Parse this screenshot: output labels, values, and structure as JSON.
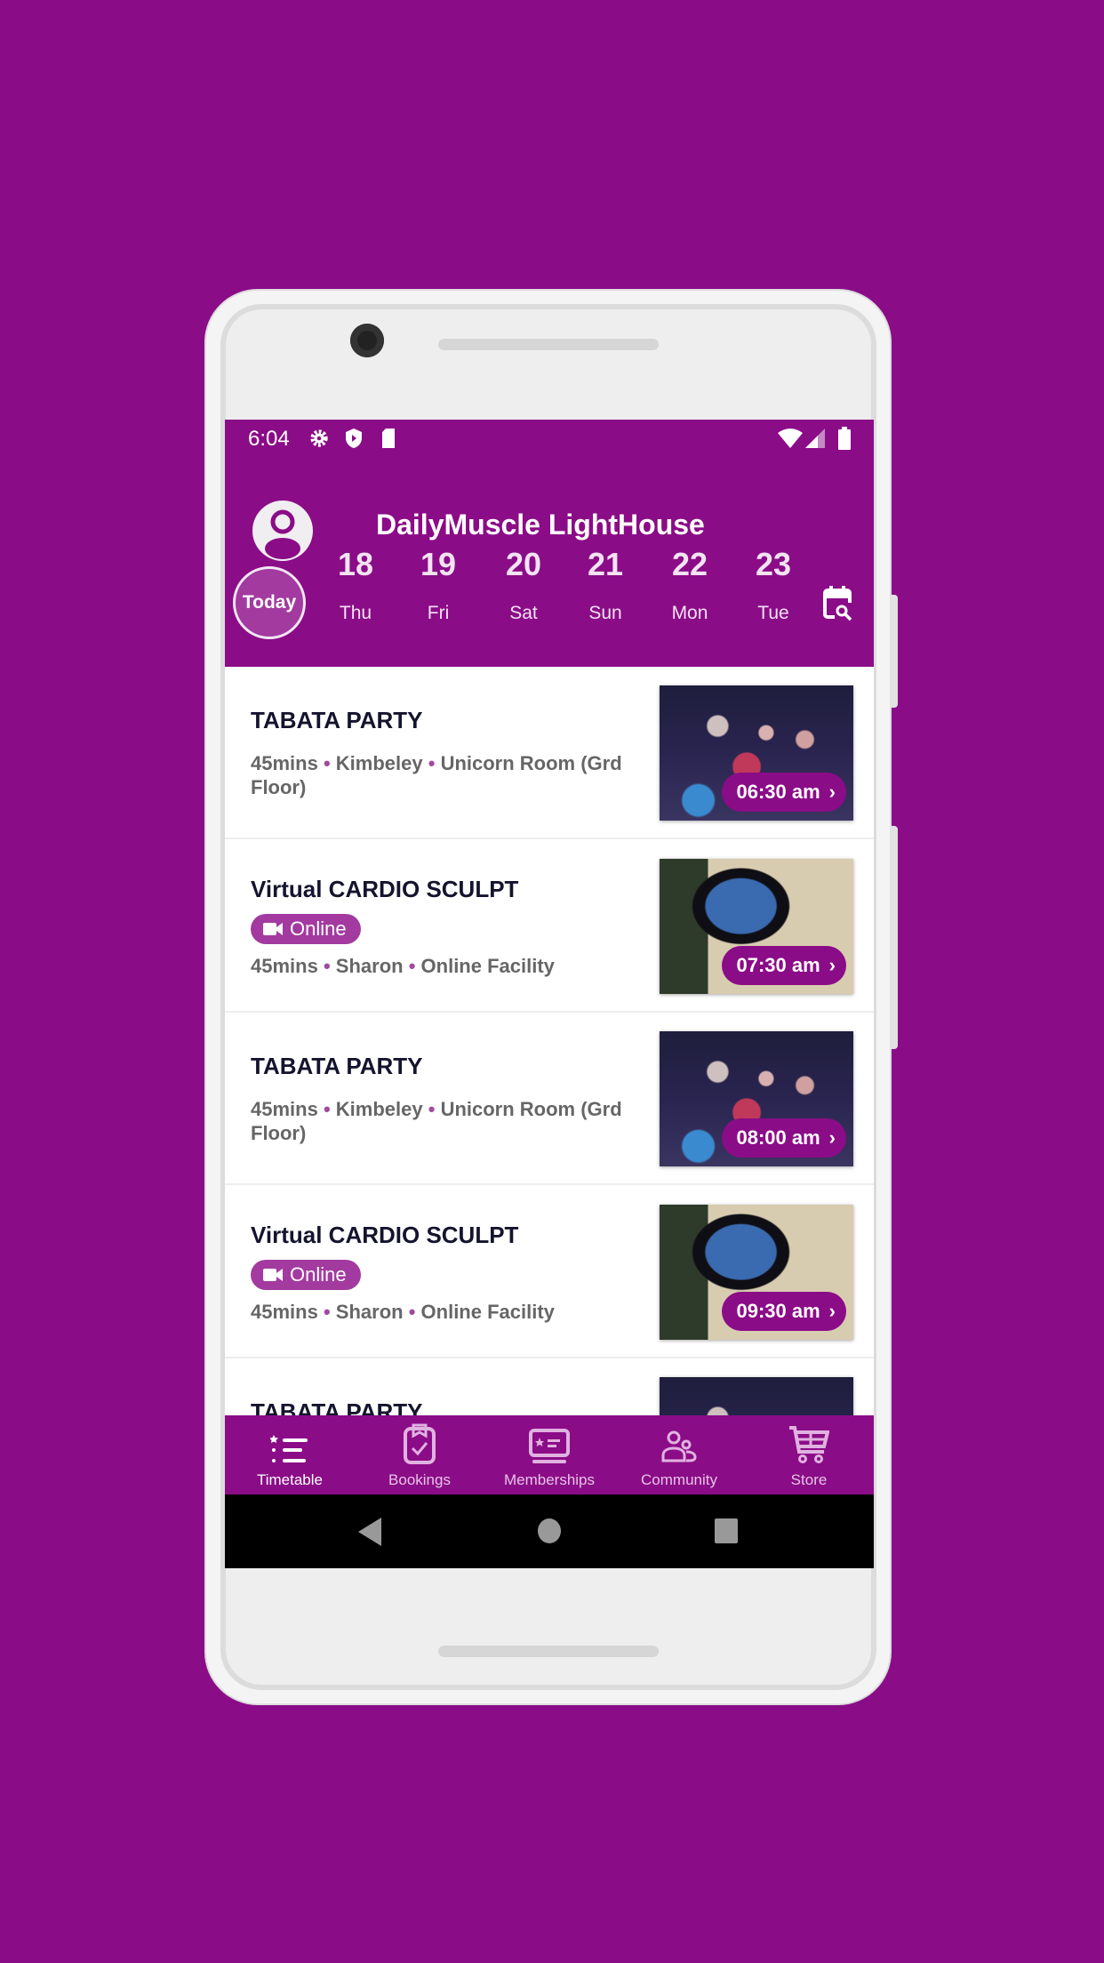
{
  "colors": {
    "brand": "#8b0c87",
    "today_circle": "#a33aa0"
  },
  "status_bar": {
    "time": "6:04",
    "icons": [
      "gear-icon",
      "shield-icon",
      "sd-card-icon",
      "wifi-icon",
      "signal-icon",
      "battery-icon"
    ]
  },
  "header": {
    "title": "DailyMuscle LightHouse",
    "today_label": "Today",
    "dates": [
      {
        "num": "18",
        "day": "Thu"
      },
      {
        "num": "19",
        "day": "Fri"
      },
      {
        "num": "20",
        "day": "Sat"
      },
      {
        "num": "21",
        "day": "Sun"
      },
      {
        "num": "22",
        "day": "Mon"
      },
      {
        "num": "23",
        "day": "Tue"
      }
    ]
  },
  "classes": [
    {
      "title": "TABATA PARTY",
      "duration": "45mins",
      "instructor": "Kimbeley",
      "location": "Unicorn Room (Grd Floor)",
      "time": "06:30 am"
    },
    {
      "title": "Virtual CARDIO SCULPT",
      "badge": "Online",
      "duration": "45mins",
      "instructor": "Sharon",
      "location": "Online Facility",
      "time": "07:30 am"
    },
    {
      "title": "TABATA PARTY",
      "duration": "45mins",
      "instructor": "Kimbeley",
      "location": "Unicorn Room (Grd Floor)",
      "time": "08:00 am"
    },
    {
      "title": "Virtual CARDIO SCULPT",
      "badge": "Online",
      "duration": "45mins",
      "instructor": "Sharon",
      "location": "Online Facility",
      "time": "09:30 am"
    },
    {
      "title": "TABATA PARTY"
    }
  ],
  "tabs": [
    {
      "label": "Timetable",
      "active": true
    },
    {
      "label": "Bookings"
    },
    {
      "label": "Memberships"
    },
    {
      "label": "Community"
    },
    {
      "label": "Store"
    }
  ]
}
